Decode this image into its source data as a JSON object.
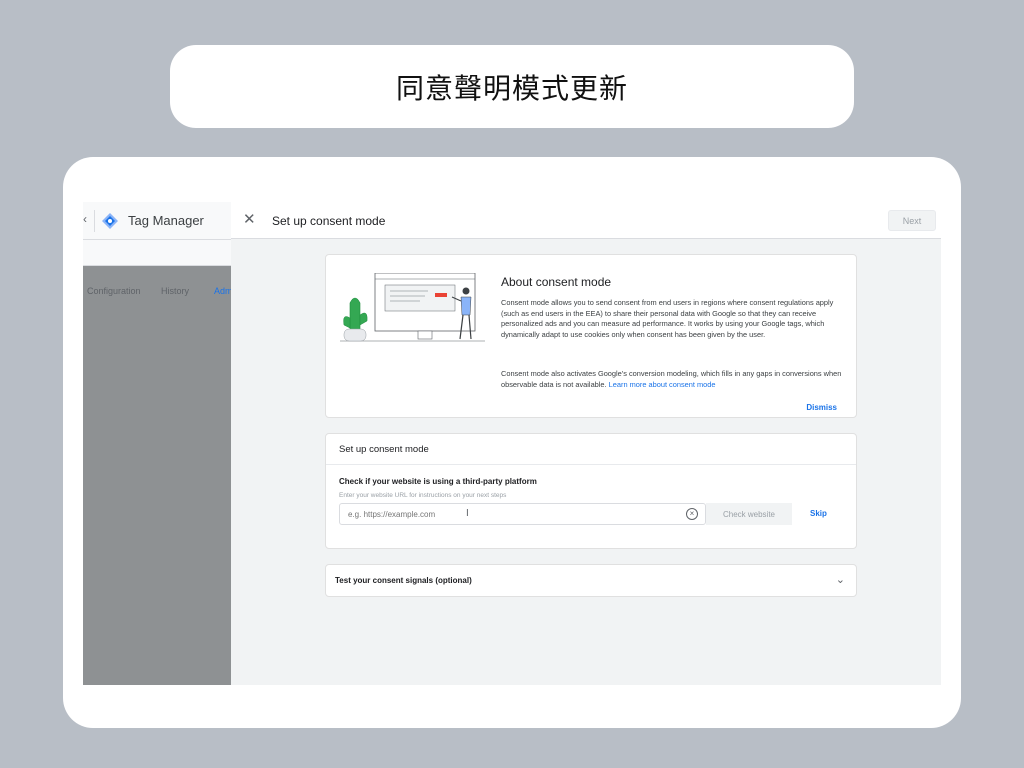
{
  "banner": {
    "title": "同意聲明模式更新"
  },
  "background_app": {
    "title": "Tag Manager",
    "tabs": [
      {
        "label": "Configuration"
      },
      {
        "label": "History"
      },
      {
        "label": "Adm"
      }
    ]
  },
  "dialog": {
    "title": "Set up consent mode",
    "next_label": "Next",
    "about": {
      "heading": "About consent mode",
      "paragraph1": "Consent mode allows you to send consent from end users in regions where consent regulations apply (such as end users in the EEA) to share their personal data with Google so that they can receive personalized ads and you can measure ad performance. It works by using your Google tags, which dynamically adapt to use cookies only when consent has been given by the user.",
      "paragraph2": "Consent mode also activates Google's conversion modeling, which fills in any gaps in conversions when observable data is not available.",
      "link_label": "Learn more about consent mode",
      "dismiss_label": "Dismiss"
    },
    "setup": {
      "heading": "Set up consent mode",
      "check_heading": "Check if your website is using a third-party platform",
      "check_sub": "Enter your website URL for instructions on your next steps",
      "url_placeholder": "e.g. https://example.com",
      "check_button_label": "Check website",
      "skip_label": "Skip"
    },
    "test": {
      "heading": "Test your consent signals (optional)"
    }
  },
  "colors": {
    "accent": "#1a73e8",
    "background": "#b8bec6",
    "plant": "#34a853"
  }
}
